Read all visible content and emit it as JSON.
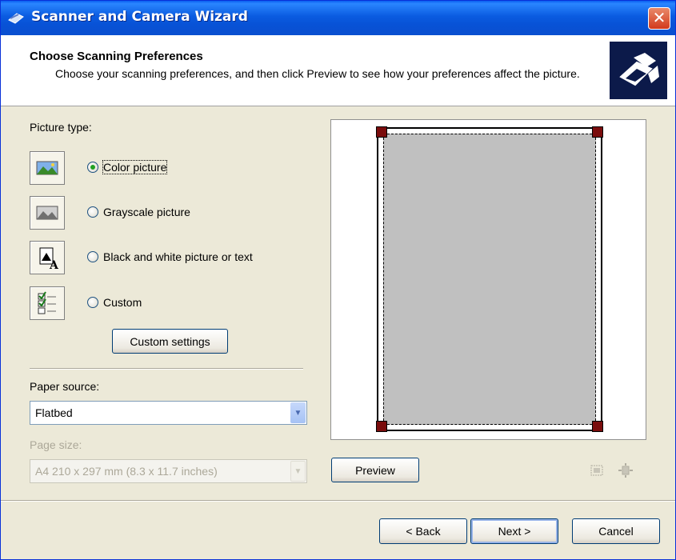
{
  "window": {
    "title": "Scanner and Camera Wizard",
    "close_glyph": "✕"
  },
  "header": {
    "title": "Choose Scanning Preferences",
    "description": "Choose your scanning preferences, and then click Preview to see how your preferences affect the picture."
  },
  "picture_type": {
    "label": "Picture type:",
    "options": [
      {
        "label": "Color picture",
        "icon": "color-photo-icon",
        "checked": true
      },
      {
        "label": "Grayscale picture",
        "icon": "grayscale-photo-icon",
        "checked": false
      },
      {
        "label": "Black and white picture or text",
        "icon": "black-white-text-icon",
        "checked": false
      },
      {
        "label": "Custom",
        "icon": "custom-settings-icon",
        "checked": false
      }
    ],
    "custom_settings_button": "Custom settings"
  },
  "paper_source": {
    "label": "Paper source:",
    "value": "Flatbed"
  },
  "page_size": {
    "label": "Page size:",
    "value": "A4 210 x 297 mm (8.3 x 11.7 inches)",
    "disabled": true
  },
  "preview": {
    "button": "Preview",
    "tools": [
      "crop-to-fit-icon",
      "zoom-to-selection-icon"
    ]
  },
  "footer": {
    "back": "< Back",
    "next": "Next >",
    "cancel": "Cancel"
  },
  "colors": {
    "titlebar": "#0a5be0",
    "dialog_bg": "#ece9d8",
    "scan_area": "#c0c0c0",
    "handle": "#7a0c0c"
  }
}
